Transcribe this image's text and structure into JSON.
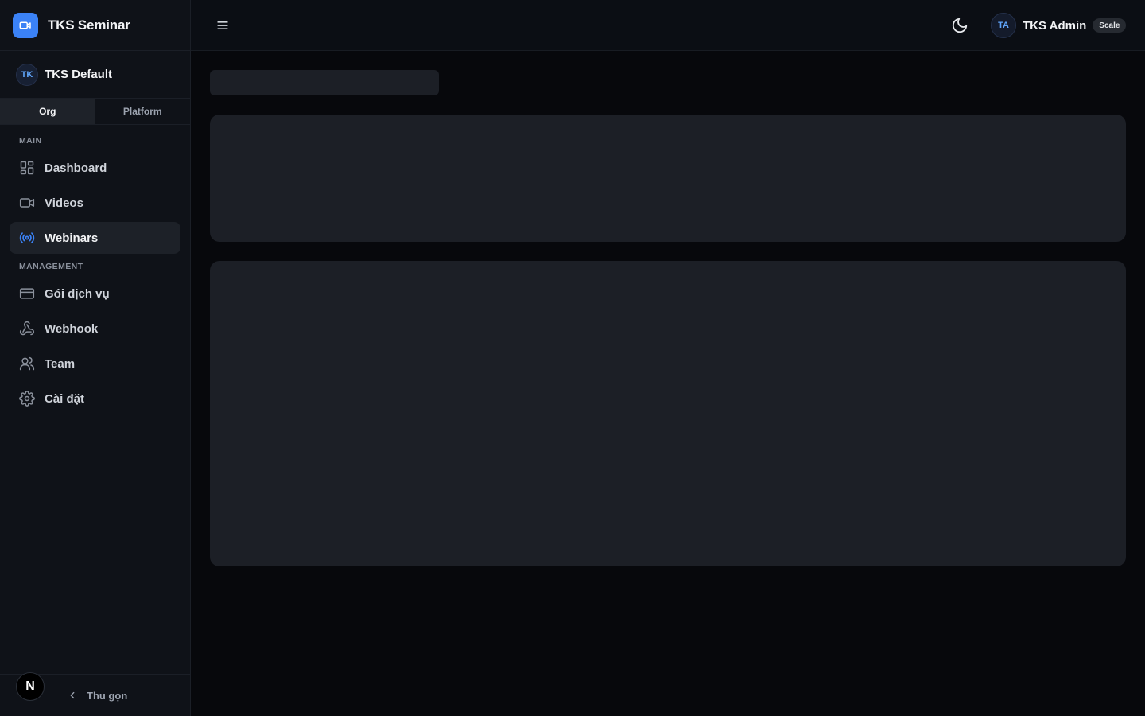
{
  "brand": {
    "title": "TKS Seminar",
    "icon": "video-camera-icon",
    "accent": "#3b82f6"
  },
  "org": {
    "avatar_initials": "TK",
    "name": "TKS Default"
  },
  "scope_tabs": [
    {
      "label": "Org",
      "active": true
    },
    {
      "label": "Platform",
      "active": false
    }
  ],
  "sidebar": {
    "sections": [
      {
        "label": "MAIN",
        "items": [
          {
            "label": "Dashboard",
            "icon": "grid-icon",
            "active": false
          },
          {
            "label": "Videos",
            "icon": "video-icon",
            "active": false
          },
          {
            "label": "Webinars",
            "icon": "broadcast-icon",
            "active": true
          }
        ]
      },
      {
        "label": "MANAGEMENT",
        "items": [
          {
            "label": "Gói dịch vụ",
            "icon": "credit-card-icon",
            "active": false
          },
          {
            "label": "Webhook",
            "icon": "webhook-icon",
            "active": false
          },
          {
            "label": "Team",
            "icon": "users-icon",
            "active": false
          },
          {
            "label": "Cài đặt",
            "icon": "gear-icon",
            "active": false
          }
        ]
      }
    ],
    "footer": {
      "badge": "N",
      "collapse_label": "Thu gọn"
    }
  },
  "topbar": {
    "user": {
      "initials": "TA",
      "name": "TKS Admin",
      "plan": "Scale"
    }
  }
}
